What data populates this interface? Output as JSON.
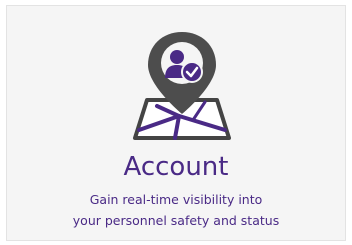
{
  "card": {
    "title": "Account",
    "description_line1": "Gain real-time visibility into",
    "description_line2": "your personnel safety and status",
    "accent_color": "#4a2a86",
    "icon": "location-pin-user-check-icon"
  }
}
